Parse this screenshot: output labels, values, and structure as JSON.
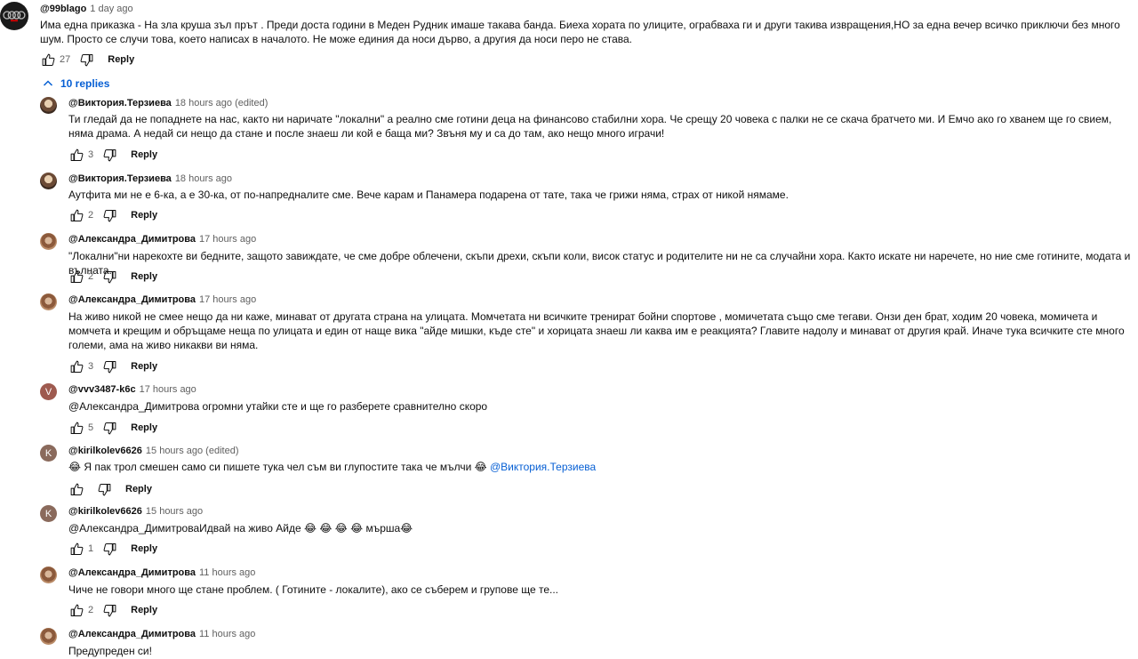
{
  "top_comment": {
    "author": "@99blago",
    "time": "1 day ago",
    "text": "Има една приказка - На зла круша зъл прът . Преди доста години в Меден Рудник имаше такава банда. Биеха хората по улиците, ограбваха ги и други такива извращения,НО за една вечер всичко приключи без много шум. Просто се случи това, което написах в началото. Не може единия да носи дърво, а другия да носи перо не става.",
    "likes": "27",
    "reply_label": "Reply"
  },
  "replies_toggle": {
    "label": "10 replies"
  },
  "replies": [
    {
      "author": "@Виктория.Терзиева",
      "time": "18 hours ago (edited)",
      "text": "Ти гледай да не попаднете на нас, както ни наричате \"локални\" а реално сме готини деца на финансово стабилни хора. Че срещу 20 човека с палки не се скача братчето ми. И Емчо ако го хванем ще го свием, няма драма. А недай си нещо да стане и после знаеш ли кой е баща ми? Звъня му и са до там, ако нещо много играчи!",
      "likes": "3",
      "reply_label": "Reply"
    },
    {
      "author": "@Виктория.Терзиева",
      "time": "18 hours ago",
      "text": "Аутфита ми не е 6-ка, а е 30-ка, от по-напредналите сме. Вече карам и Панамера подарена от тате, така че грижи няма, страх от никой нямаме.",
      "likes": "2",
      "reply_label": "Reply"
    },
    {
      "author": "@Александра_Димитрова",
      "time": "17 hours ago",
      "text": "\"Локални\"ни нарекохте ви бедните, защото завиждате, че сме добре облечени, скъпи дрехи, скъпи коли, висок статус и родителите ни не са случайни хора. Както искате ни наречете, но ние сме готините, модата и вълната.",
      "likes": "2",
      "reply_label": "Reply"
    },
    {
      "author": "@Александра_Димитрова",
      "time": "17 hours ago",
      "text": "На живо никой не смее нещо да ни каже, минават от другата страна на улицата. Момчетата ни всичките тренират бойни спортове , момичетата също сме тегави. Онзи ден брат, ходим 20 човека, момичета и момчета и крещим и обръщаме неща по улицата и един от наще вика \"айде мишки, къде сте\" и хорицата знаеш ли каква им е реакцията? Главите надолу и минават от другия край. Иначе тука всичките сте много големи, ама на живо никакви ви няма.",
      "likes": "3",
      "reply_label": "Reply"
    },
    {
      "author": "@vvv3487-k6c",
      "time": "17 hours ago",
      "avatar_letter": "V",
      "text": "@Александра_Димитрова огромни утайки сте и ще го разберете сравнително скоро",
      "likes": "5",
      "reply_label": "Reply"
    },
    {
      "author": "@kirilkolev6626",
      "time": "15 hours ago (edited)",
      "avatar_letter": "K",
      "text": "😂 Я пак трол смешен само си пишете тука чел съм ви глупостите така че мълчи 😂",
      "mention": "@Виктория.Терзиева",
      "likes": "",
      "reply_label": "Reply"
    },
    {
      "author": "@kirilkolev6626",
      "time": "15 hours ago",
      "avatar_letter": "K",
      "text": "@Александра_ДимитроваИдвай на живо Айде 😂 😂 😂 😂  мърша😂",
      "likes": "1",
      "reply_label": "Reply"
    },
    {
      "author": "@Александра_Димитрова",
      "time": "11 hours ago",
      "text": "Чиче не говори много ще стане проблем. ( Готините - локалите), ако се съберем и групове ще те...",
      "likes": "2",
      "reply_label": "Reply"
    },
    {
      "author": "@Александра_Димитрова",
      "time": "11 hours ago",
      "text": "Предупреден си!"
    }
  ]
}
